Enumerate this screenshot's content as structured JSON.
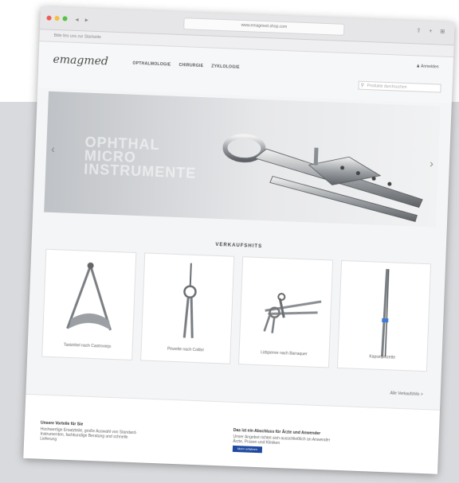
{
  "browser": {
    "url": "www.emagmed-shop.com",
    "bookmarks_text": "Bitte lies uns zur Startseite"
  },
  "site": {
    "logo": "emagmed",
    "nav": [
      "OPTHALMOLOGIE",
      "CHIRURGIE",
      "ZYKLOLOGIE"
    ],
    "account": "Anmelden",
    "search_placeholder": "Produkte durchsuchen"
  },
  "hero": {
    "lines": [
      "OPHTHAL",
      "MICRO",
      "INSTRUMENTE"
    ]
  },
  "bestsellers": {
    "title": "VERKAUFSHITS",
    "products": [
      {
        "name": "Tastzirkel nach Castroviejo"
      },
      {
        "name": "Pinzette nach Colibri"
      },
      {
        "name": "Lidsperrer nach Barraquer"
      },
      {
        "name": "Kapselpinzette"
      }
    ],
    "more_link": "Alle Verkaufshits >"
  },
  "footer": {
    "col1_title": "Unsere Vorteile für Sie",
    "col1_text": [
      "Hochwertige Ersatzteile, große Auswahl von Standard-",
      "Instrumenten, fachkundige Beratung und schnelle",
      "Lieferung"
    ],
    "col2_title": "Das ist ein Abschluss für Ärzte und Anwender",
    "col2_text": [
      "Unser Angebot richtet sich ausschließlich an Anwender",
      "Ärzte, Praxen und Kliniken"
    ],
    "col2_button": "Mehr erfahren"
  },
  "colors": {
    "accent": "#1f4aa0",
    "backdrop": "#d9dadd"
  }
}
